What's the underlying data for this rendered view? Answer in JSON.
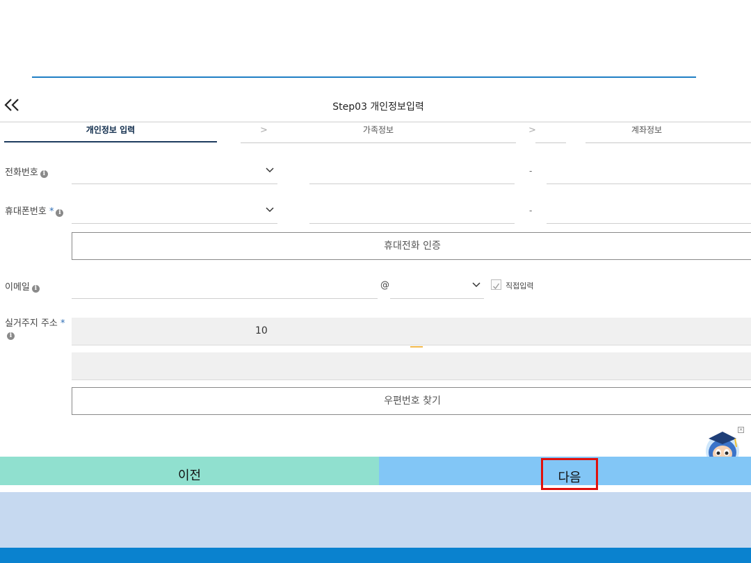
{
  "header": {
    "title": "Step03 개인정보입력"
  },
  "steps": [
    {
      "label": "개인정보 입력",
      "active": true
    },
    {
      "label": "가족정보",
      "active": false
    },
    {
      "label": "계좌정보",
      "active": false
    }
  ],
  "form": {
    "phone": {
      "label": "전화번호",
      "area_value": "",
      "middle_value": "",
      "last_value": "",
      "dash": "-"
    },
    "mobile": {
      "label": "휴대폰번호",
      "required_mark": "*",
      "area_value": "",
      "middle_value": "",
      "last_value": "",
      "dash": "-"
    },
    "mobile_verify_button": "휴대전화 인증",
    "email": {
      "label": "이메일",
      "local_value": "",
      "at": "@",
      "domain_value": "",
      "direct_input_label": "직접입력",
      "direct_input_checked": true
    },
    "address": {
      "label": "실거주지 주소",
      "required_mark": "*",
      "line1_value": "10",
      "line2_value": ""
    },
    "zip_search_button": "우편번호 찾기"
  },
  "nav": {
    "prev_label": "이전",
    "next_label": "다음"
  },
  "colors": {
    "accent_line": "#1f7fc4",
    "prev_bg": "#90e0cf",
    "next_bg": "#82c6f6",
    "highlight_border": "#e0100c",
    "footer_panel": "#c6d9f0",
    "footer_bar": "#0a82cf"
  },
  "icons": {
    "back": "double-chevron-left-icon",
    "info": "info-icon",
    "dropdown": "chevron-down-icon",
    "checkbox": "check-icon",
    "mascot": "mascot-icon",
    "close": "close-icon"
  }
}
